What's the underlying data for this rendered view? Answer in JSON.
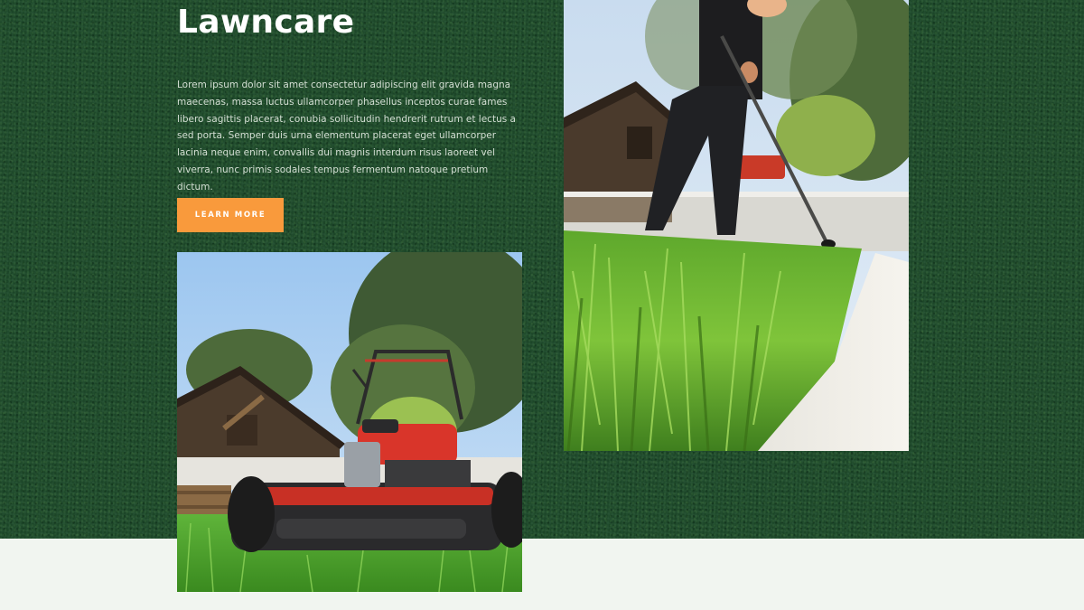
{
  "section": {
    "title": "Lawncare",
    "description": "Lorem ipsum dolor sit amet consectetur adipiscing elit gravida magna maecenas, massa luctus ullamcorper phasellus inceptos curae fames libero sagittis placerat, conubia sollicitudin hendrerit rutrum et lectus a sed porta. Semper duis urna elementum placerat eget ullamcorper lacinia neque enim, convallis dui magnis interdum risus laoreet vel viverra, nunc primis sodales tempus fermentum natoque pretium dictum.",
    "button_label": "LEARN MORE"
  },
  "colors": {
    "grass_background": "#1f4d2c",
    "light_background": "#f1f5f0",
    "button_accent": "#f99a3c",
    "title_text": "#ffffff"
  },
  "images": {
    "mower_photo": "lawn-mower-photo",
    "trimmer_photo": "grass-trimmer-photo"
  }
}
